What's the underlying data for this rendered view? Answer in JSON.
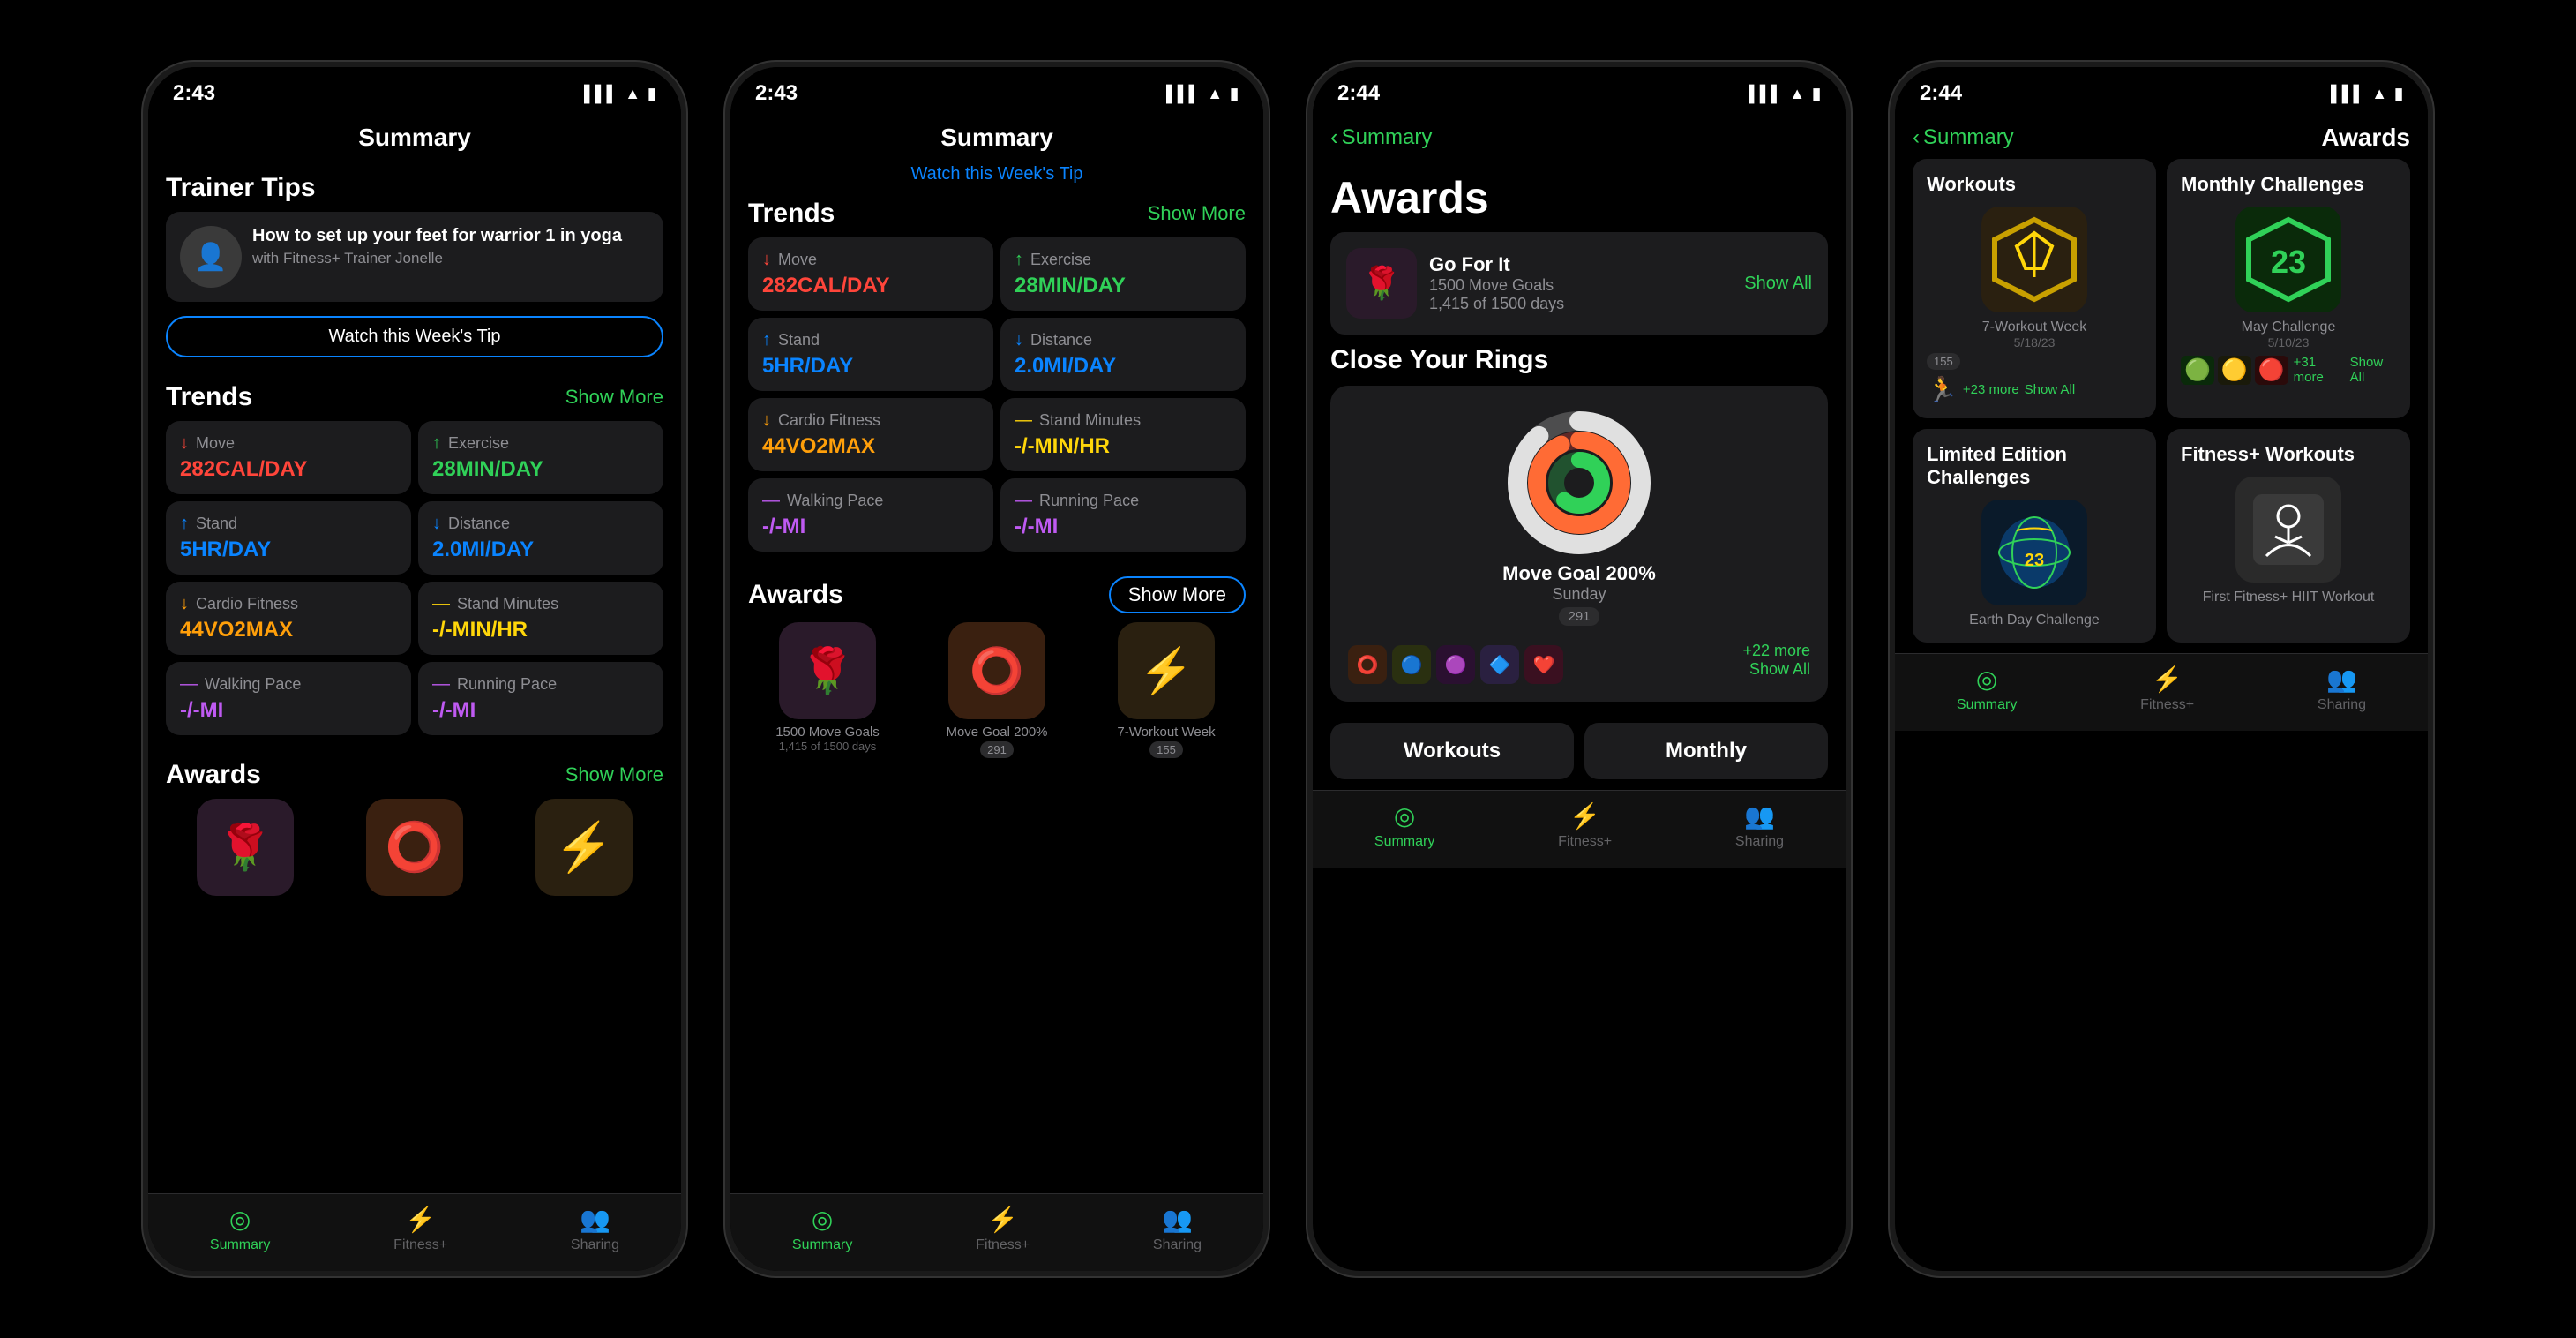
{
  "phones": [
    {
      "id": "phone1",
      "time": "2:43",
      "title": "Summary",
      "sections": {
        "trainerTips": {
          "label": "Trainer Tips",
          "tip": "How to set up your feet for warrior 1 in yoga",
          "sub": "with Fitness+ Trainer Jonelle",
          "watchBtn": "Watch this Week's Tip"
        },
        "trends": {
          "label": "Trends",
          "showMore": "Show More",
          "items": [
            {
              "label": "Move",
              "value": "282CAL/DAY",
              "arrow": "↓",
              "color": "red"
            },
            {
              "label": "Exercise",
              "value": "28MIN/DAY",
              "arrow": "↑",
              "color": "green"
            },
            {
              "label": "Stand",
              "value": "5HR/DAY",
              "arrow": "↑",
              "color": "blue"
            },
            {
              "label": "Distance",
              "value": "2.0MI/DAY",
              "arrow": "↓",
              "color": "blue"
            },
            {
              "label": "Cardio Fitness",
              "value": "44VO2MAX",
              "arrow": "↓",
              "color": "orange"
            },
            {
              "label": "Stand Minutes",
              "value": "-/-MIN/HR",
              "arrow": "—",
              "color": "yellow"
            },
            {
              "label": "Walking Pace",
              "value": "-/-MI",
              "arrow": "—",
              "color": "purple"
            },
            {
              "label": "Running Pace",
              "value": "-/-MI",
              "arrow": "—",
              "color": "purple"
            }
          ]
        },
        "awards": {
          "label": "Awards",
          "showMore": "Show More",
          "items": [
            {
              "icon": "🌹",
              "bg": "dark-flower"
            },
            {
              "icon": "⭕",
              "bg": "orange-ring"
            },
            {
              "icon": "⚡",
              "bg": "yellow-hex"
            }
          ]
        }
      },
      "tabBar": {
        "items": [
          {
            "label": "Summary",
            "active": true
          },
          {
            "label": "Fitness+",
            "active": false
          },
          {
            "label": "Sharing",
            "active": false
          }
        ]
      }
    },
    {
      "id": "phone2",
      "time": "2:43",
      "title": "Summary",
      "watchTip": "Watch this Week's Tip",
      "sections": {
        "trends": {
          "label": "Trends",
          "showMore": "Show More",
          "items": [
            {
              "label": "Move",
              "value": "282CAL/DAY",
              "arrow": "↓",
              "color": "red"
            },
            {
              "label": "Exercise",
              "value": "28MIN/DAY",
              "arrow": "↑",
              "color": "green"
            },
            {
              "label": "Stand",
              "value": "5HR/DAY",
              "arrow": "↑",
              "color": "blue"
            },
            {
              "label": "Distance",
              "value": "2.0MI/DAY",
              "arrow": "↓",
              "color": "blue"
            },
            {
              "label": "Cardio Fitness",
              "value": "44VO2MAX",
              "arrow": "↓",
              "color": "orange"
            },
            {
              "label": "Stand Minutes",
              "value": "-/-MIN/HR",
              "arrow": "—",
              "color": "yellow"
            },
            {
              "label": "Walking Pace",
              "value": "-/-MI",
              "arrow": "—",
              "color": "purple"
            },
            {
              "label": "Running Pace",
              "value": "-/-MI",
              "arrow": "—",
              "color": "purple"
            }
          ]
        },
        "awards": {
          "label": "Awards",
          "showMore": "Show More",
          "items": [
            {
              "icon": "🌹",
              "name": "1500 Move Goals",
              "sub": "1,415 of 1500 days",
              "bg": "dark-flower"
            },
            {
              "icon": "⭕",
              "name": "Move Goal 200%",
              "sub": "",
              "count": "291",
              "bg": "orange-ring"
            },
            {
              "icon": "⚡",
              "name": "7-Workout Week",
              "sub": "",
              "count": "155",
              "bg": "yellow-hex"
            }
          ]
        }
      },
      "tabBar": {
        "items": [
          {
            "label": "Summary",
            "active": true
          },
          {
            "label": "Fitness+",
            "active": false
          },
          {
            "label": "Sharing",
            "active": false
          }
        ]
      }
    },
    {
      "id": "phone3",
      "time": "2:44",
      "backLabel": "Summary",
      "title": "Awards",
      "goForIt": {
        "title": "Go For It",
        "sub1": "1500 Move Goals",
        "sub2": "1,415 of 1500 days",
        "showAll": "Show All"
      },
      "closeRings": {
        "title": "Close Your Rings",
        "badge": "Move Goal 200%",
        "day": "Sunday",
        "count": "291",
        "plusMore": "+22 more",
        "showAll": "Show All"
      },
      "bottomTabs": {
        "workouts": "Workouts",
        "monthly": "Monthly"
      },
      "tabBar": {
        "items": [
          {
            "label": "Summary",
            "active": true
          },
          {
            "label": "Fitness+",
            "active": false
          },
          {
            "label": "Sharing",
            "active": false
          }
        ]
      }
    },
    {
      "id": "phone4",
      "time": "2:44",
      "backLabel": "Summary",
      "title": "Awards",
      "categories": [
        {
          "title": "Workouts",
          "badge": "⚡",
          "badgeBg": "#2a2010",
          "name": "7-Workout Week",
          "date": "5/18/23",
          "count": "155",
          "plusMore": "+23 more",
          "showAll": "Show All"
        },
        {
          "title": "Monthly Challenges",
          "badge": "🌿",
          "badgeBg": "#0a2a0a",
          "name": "May Challenge",
          "date": "5/10/23",
          "plusMore": "+31 more",
          "showAll": "Show All"
        },
        {
          "title": "Limited Edition Challenges",
          "badge": "🌍",
          "badgeBg": "#0a1a2a",
          "name": "Earth Day Challenge",
          "date": "",
          "plusMore": "",
          "showAll": ""
        },
        {
          "title": "Fitness+ Workouts",
          "badge": "🏃",
          "badgeBg": "#1a1a1a",
          "name": "First Fitness+ HIIT Workout",
          "date": "",
          "plusMore": "",
          "showAll": ""
        }
      ],
      "tabBar": {
        "items": [
          {
            "label": "Summary",
            "active": true
          },
          {
            "label": "Fitness+",
            "active": false
          },
          {
            "label": "Sharing",
            "active": false
          }
        ]
      }
    }
  ]
}
